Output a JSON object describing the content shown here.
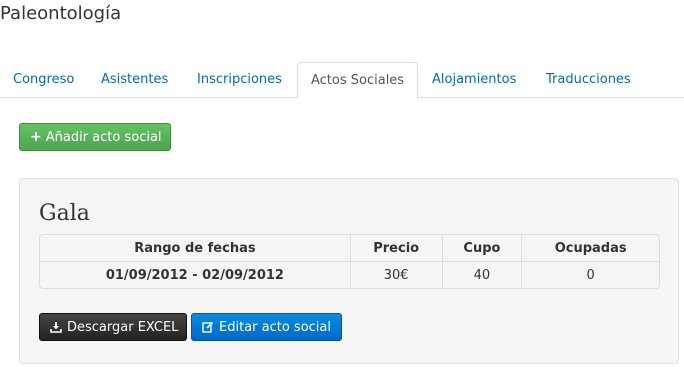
{
  "page": {
    "title": "Paleontología"
  },
  "tabs": [
    {
      "label": "Congreso",
      "active": false
    },
    {
      "label": "Asistentes",
      "active": false
    },
    {
      "label": "Inscripciones",
      "active": false
    },
    {
      "label": "Actos Sociales",
      "active": true
    },
    {
      "label": "Alojamientos",
      "active": false
    },
    {
      "label": "Traducciones",
      "active": false
    }
  ],
  "add_button": {
    "label": "Añadir acto social",
    "icon": "plus-icon"
  },
  "event": {
    "title": "Gala",
    "table": {
      "headers": [
        "Rango de fechas",
        "Precio",
        "Cupo",
        "Ocupadas"
      ],
      "rows": [
        [
          "01/09/2012 - 02/09/2012",
          "30€",
          "40",
          "0"
        ]
      ]
    },
    "excel_button": {
      "label": "Descargar EXCEL",
      "icon": "download-icon"
    },
    "edit_button": {
      "label": "Editar acto social",
      "icon": "edit-icon"
    }
  },
  "colors": {
    "link": "#0a6a9e",
    "success": "#51a351",
    "dark": "#222222",
    "primary": "#0068c9"
  }
}
